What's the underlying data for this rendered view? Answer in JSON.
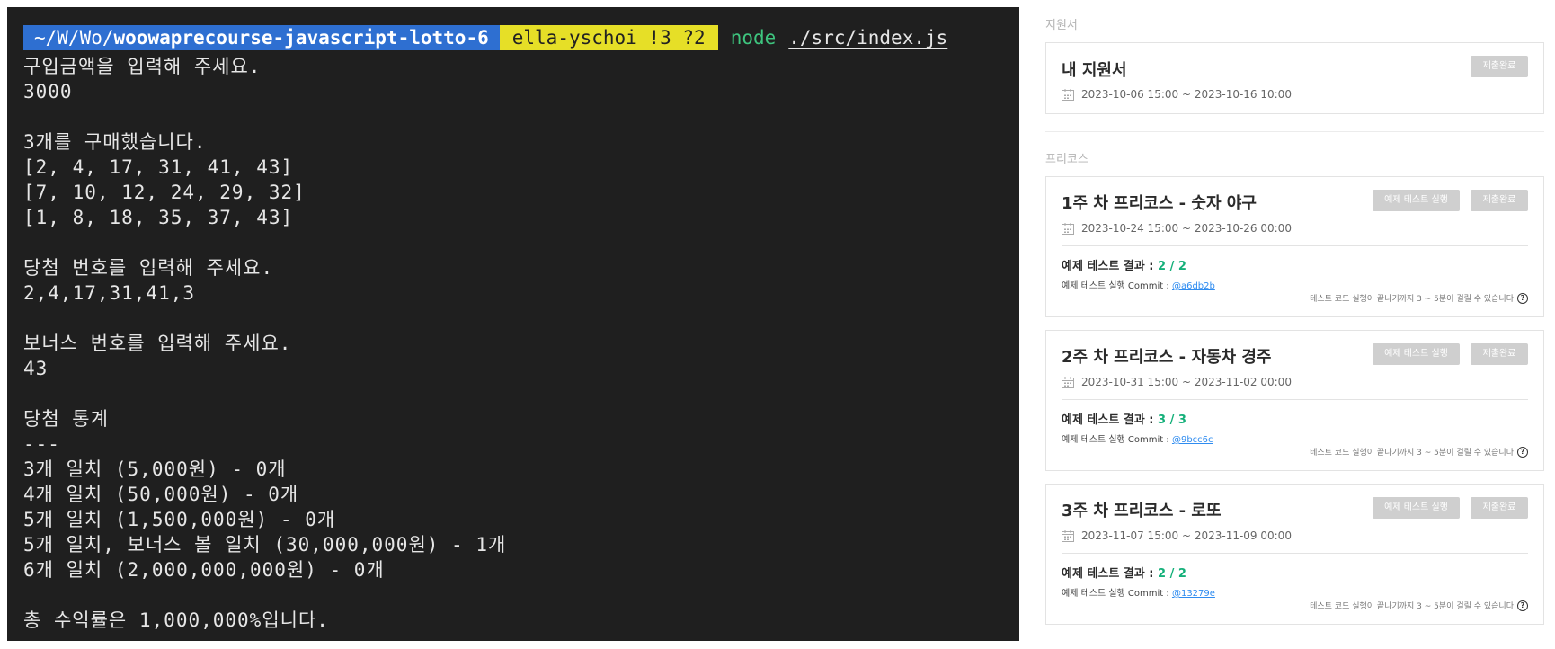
{
  "terminal": {
    "prompt": {
      "path_prefix": "~/W/Wo/",
      "path_repo": "woowaprecourse-javascript-lotto-6",
      "branch": "ella-yschoi !3 ?2",
      "command": "node",
      "argument": "./src/index.js"
    },
    "lines": [
      "구입금액을 입력해 주세요.",
      "3000",
      "",
      "3개를 구매했습니다.",
      "[2, 4, 17, 31, 41, 43]",
      "[7, 10, 12, 24, 29, 32]",
      "[1, 8, 18, 35, 37, 43]",
      "",
      "당첨 번호를 입력해 주세요.",
      "2,4,17,31,41,3",
      "",
      "보너스 번호를 입력해 주세요.",
      "43",
      "",
      "당첨 통계",
      "---",
      "3개 일치 (5,000원) - 0개",
      "4개 일치 (50,000원) - 0개",
      "5개 일치 (1,500,000원) - 0개",
      "5개 일치, 보너스 볼 일치 (30,000,000원) - 1개",
      "6개 일치 (2,000,000,000원) - 0개",
      "",
      "총 수익률은 1,000,000%입니다."
    ]
  },
  "panel": {
    "application_section": "지원서",
    "precourse_section": "프리코스",
    "application_card": {
      "title": "내 지원서",
      "date": "2023-10-06 15:00 ~ 2023-10-16 10:00",
      "submit_label": "제출완료"
    },
    "precourse_cards": [
      {
        "title": "1주 차 프리코스 - 숫자 야구",
        "date": "2023-10-24 15:00 ~ 2023-10-26 00:00",
        "test_label": "예제 테스트 실행",
        "submit_label": "제출완료",
        "result_label": "예제 테스트 결과 : ",
        "result_score": "2 / 2",
        "commit_label": "예제 테스트 실행 Commit : ",
        "commit_hash": "@a6db2b",
        "note": "테스트 코드 실행이 끝나기까지 3 ~ 5분이 걸릴 수 있습니다"
      },
      {
        "title": "2주 차 프리코스 - 자동차 경주",
        "date": "2023-10-31 15:00 ~ 2023-11-02 00:00",
        "test_label": "예제 테스트 실행",
        "submit_label": "제출완료",
        "result_label": "예제 테스트 결과 : ",
        "result_score": "3 / 3",
        "commit_label": "예제 테스트 실행 Commit : ",
        "commit_hash": "@9bcc6c",
        "note": "테스트 코드 실행이 끝나기까지 3 ~ 5분이 걸릴 수 있습니다"
      },
      {
        "title": "3주 차 프리코스 - 로또",
        "date": "2023-11-07 15:00 ~ 2023-11-09 00:00",
        "test_label": "예제 테스트 실행",
        "submit_label": "제출완료",
        "result_label": "예제 테스트 결과 : ",
        "result_score": "2 / 2",
        "commit_label": "예제 테스트 실행 Commit : ",
        "commit_hash": "@13279e",
        "note": "테스트 코드 실행이 끝나기까지 3 ~ 5분이 걸릴 수 있습니다"
      }
    ],
    "colors": {
      "score_green": "#15b07a",
      "link_blue": "#2f8cf0",
      "button_gray": "#cfcfcf",
      "path_blue": "#2e6fd1",
      "branch_yellow": "#e6df27",
      "node_green": "#3ec47e"
    }
  }
}
